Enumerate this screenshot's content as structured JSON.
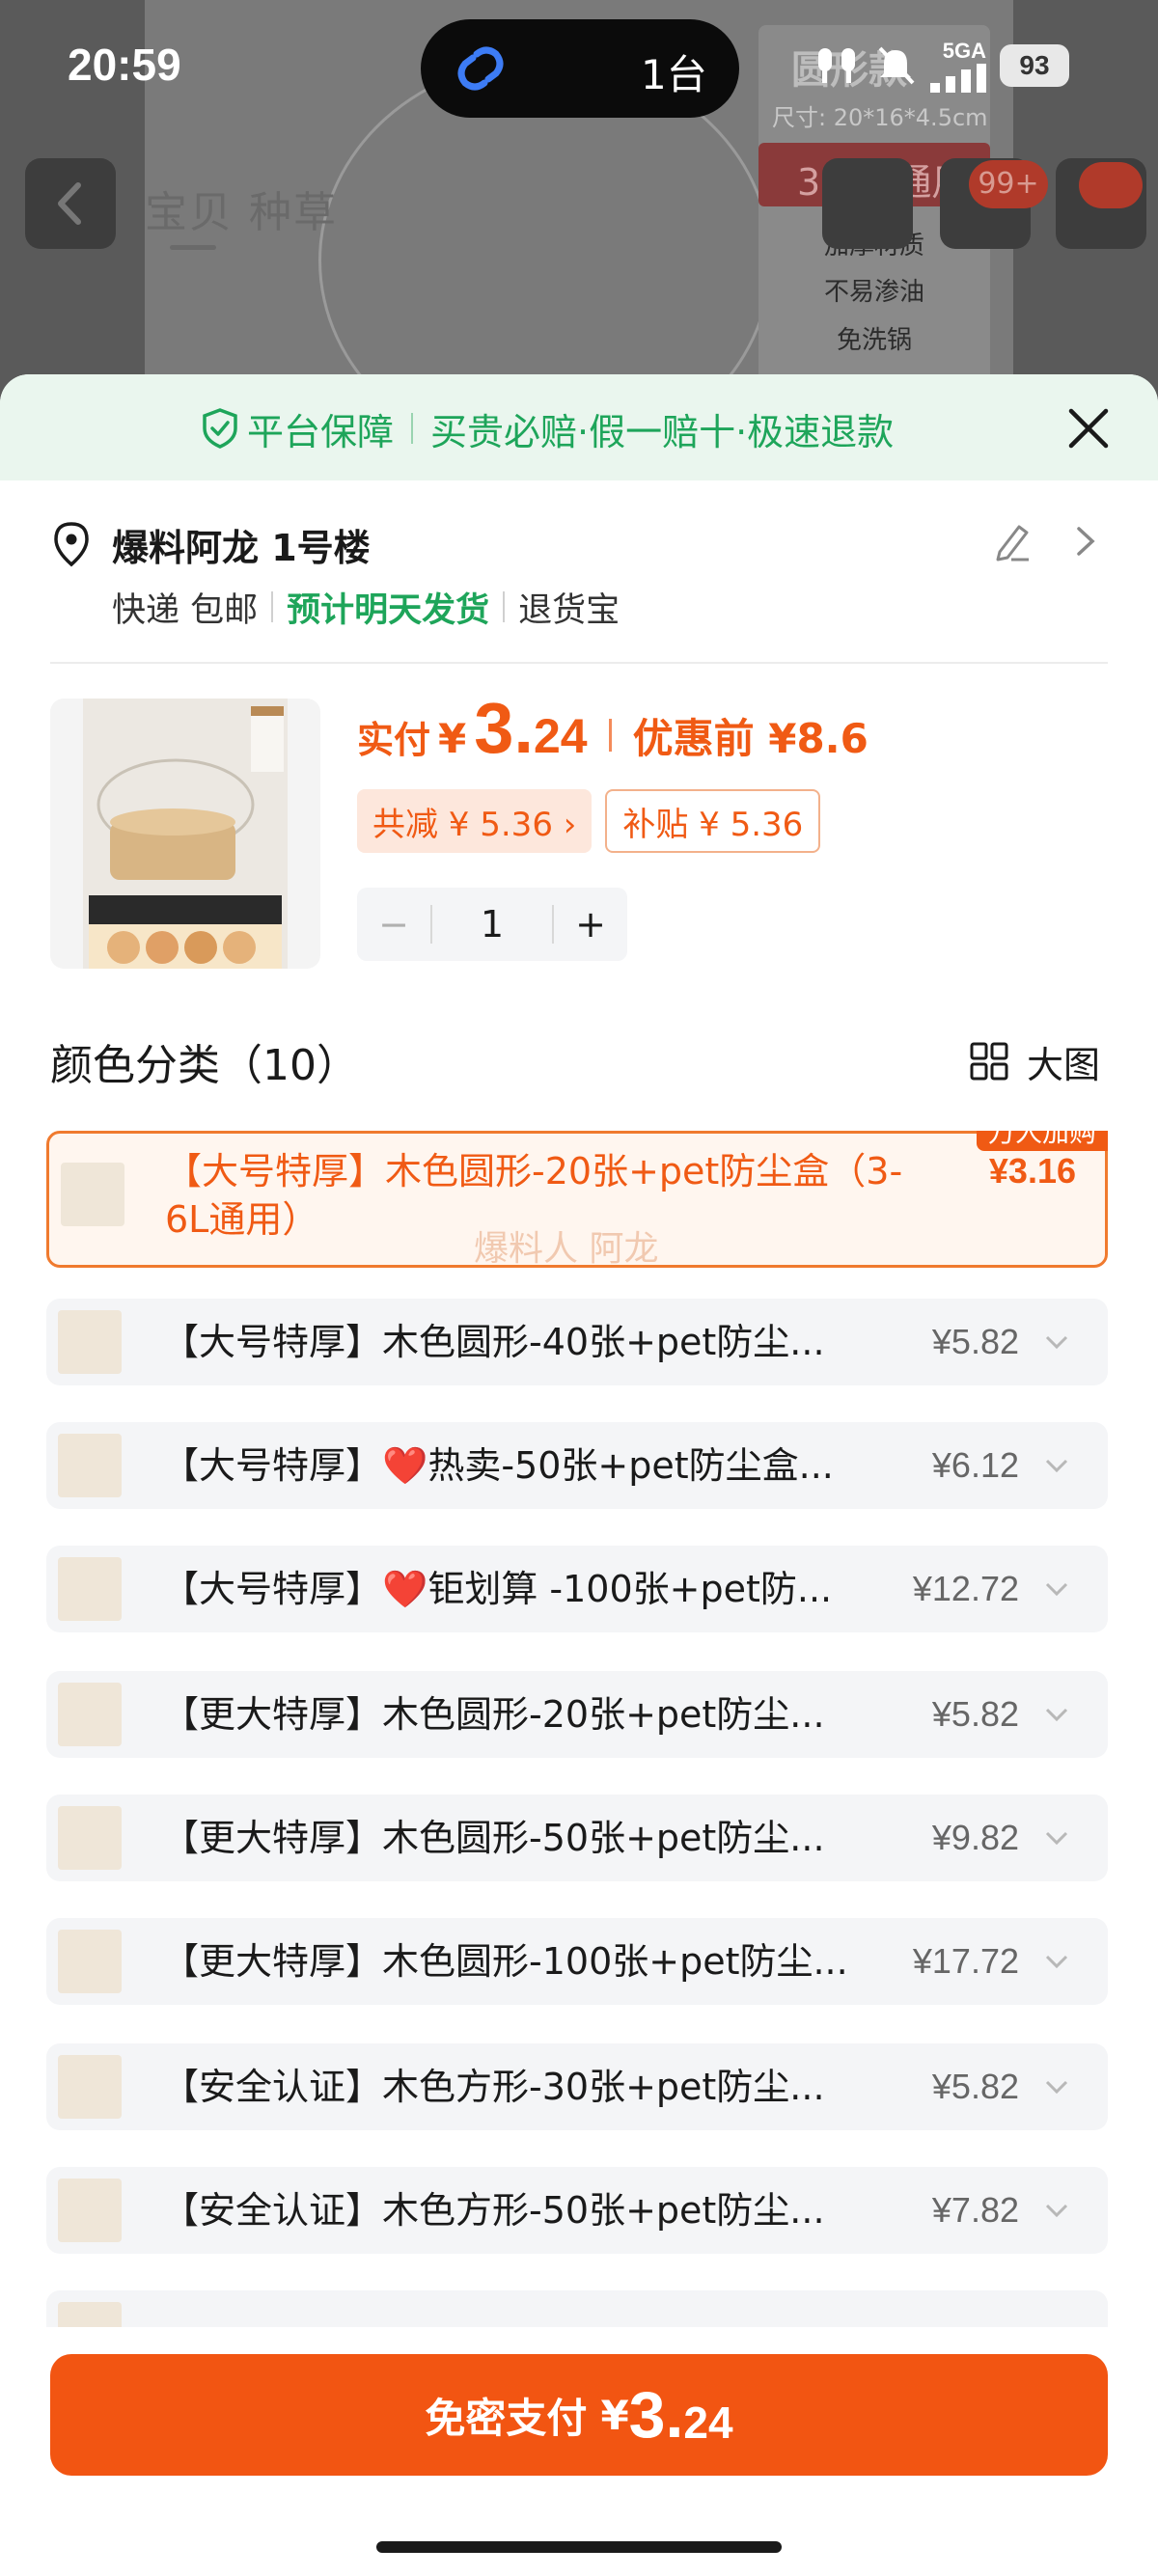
{
  "status_bar": {
    "time": "20:59",
    "island_text": "1台",
    "network": "5GA",
    "battery": "93"
  },
  "background": {
    "tabs": "宝贝 种草",
    "info_title": "圆形款",
    "info_size": "尺寸: 20*16*4.5cm",
    "info_banner": "3~6L通用",
    "info_lines": [
      "加厚材质",
      "不易渗油",
      "免洗锅"
    ],
    "cart_badge": "99+"
  },
  "guarantee": {
    "title": "平台保障",
    "text": "买贵必赔·假一赔十·极速退款"
  },
  "address": {
    "text": "爆料阿龙 1号楼",
    "shipping": "快递 包邮",
    "eta": "预计明天发货",
    "returns": "退货宝"
  },
  "price": {
    "label": "实付",
    "yen": "¥",
    "int": "3.",
    "dec": "24",
    "before": "优惠前 ¥8.6",
    "tag_discount": "共减 ¥ 5.36 ›",
    "tag_subsidy": "补贴 ¥ 5.36"
  },
  "quantity": {
    "minus": "−",
    "value": "1",
    "plus": "+"
  },
  "section": {
    "title": "颜色分类（10）",
    "big_view": "大图"
  },
  "variants": [
    {
      "label": "【大号特厚】木色圆形-20张+pet防尘盒（3-6L通用）",
      "price": "¥3.16",
      "badge": "万人加购",
      "watermark": "爆料人 阿龙"
    },
    {
      "label": "【大号特厚】木色圆形-40张+pet防尘...",
      "price": "¥5.82"
    },
    {
      "label": "【大号特厚】❤️热卖-50张+pet防尘盒...",
      "price": "¥6.12"
    },
    {
      "label": "【大号特厚】❤️钜划算 -100张+pet防...",
      "price": "¥12.72"
    },
    {
      "label": "【更大特厚】木色圆形-20张+pet防尘...",
      "price": "¥5.82"
    },
    {
      "label": "【更大特厚】木色圆形-50张+pet防尘...",
      "price": "¥9.82"
    },
    {
      "label": "【更大特厚】木色圆形-100张+pet防尘...",
      "price": "¥17.72"
    },
    {
      "label": "【安全认证】木色方形-30张+pet防尘...",
      "price": "¥5.82"
    },
    {
      "label": "【安全认证】木色方形-50张+pet防尘...",
      "price": "¥7.82"
    }
  ],
  "pay": {
    "label": "免密支付",
    "yen": "¥",
    "int": "3.",
    "dec": "24"
  },
  "colors": {
    "accent": "#f05a14",
    "green": "#1ea55a",
    "pay_button": "#f25512"
  }
}
